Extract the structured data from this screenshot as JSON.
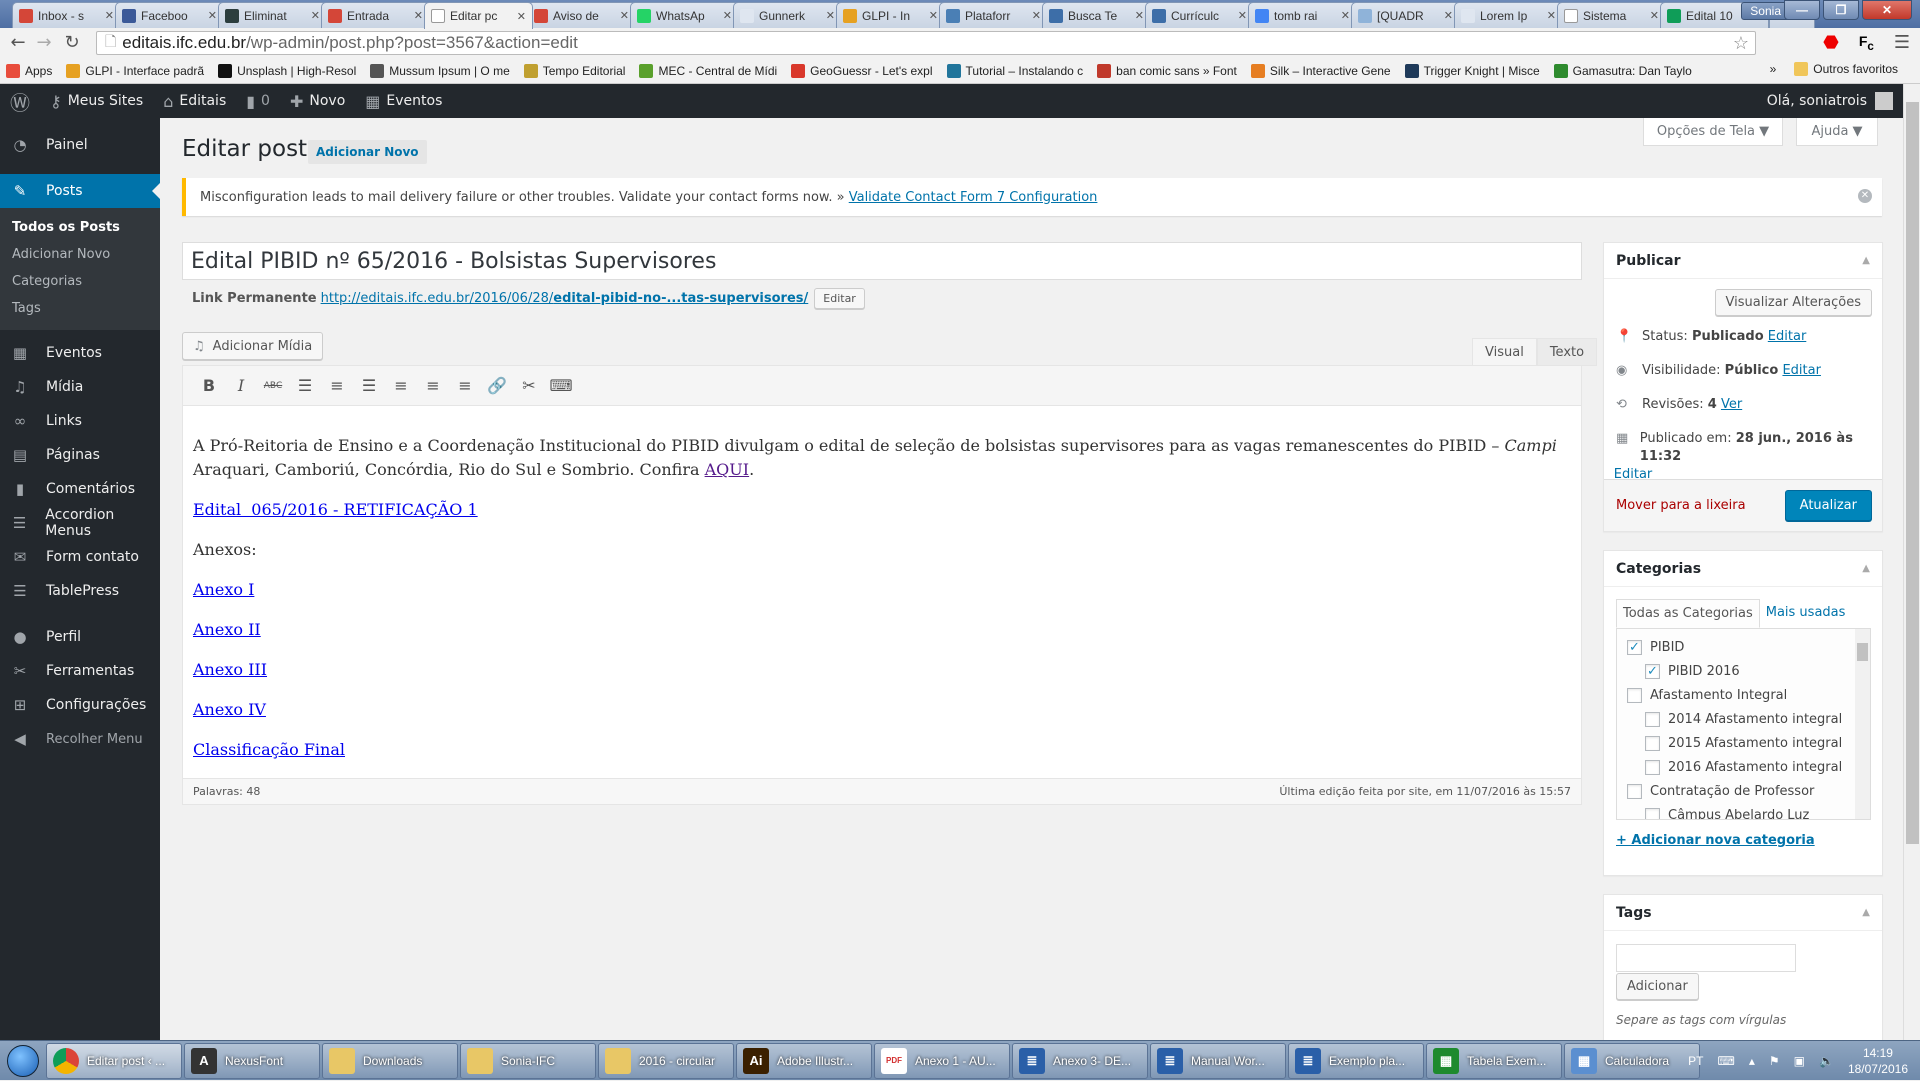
{
  "browser": {
    "tabs": [
      {
        "label": "Inbox - s",
        "icon": "gmail-icon",
        "color": "#d44638"
      },
      {
        "label": "Faceboo",
        "icon": "facebook-icon",
        "color": "#3b5998"
      },
      {
        "label": "Eliminat",
        "icon": "site-icon",
        "color": "#2c3e3e"
      },
      {
        "label": "Entrada",
        "icon": "gmail-icon",
        "color": "#d44638"
      },
      {
        "label": "Editar pc",
        "icon": "page-icon",
        "color": "#ffffff",
        "active": true
      },
      {
        "label": "Aviso de",
        "icon": "gmail-icon",
        "color": "#d44638"
      },
      {
        "label": "WhatsAp",
        "icon": "whatsapp-icon",
        "color": "#25d366"
      },
      {
        "label": "Gunnerk",
        "icon": "site-icon",
        "color": "#dfe6f0"
      },
      {
        "label": "GLPI - In",
        "icon": "glpi-icon",
        "color": "#e6a122"
      },
      {
        "label": "Plataforr",
        "icon": "site-icon",
        "color": "#4a7fb5"
      },
      {
        "label": "Busca Te",
        "icon": "lattes-icon",
        "color": "#3d6ea8"
      },
      {
        "label": "Currículc",
        "icon": "lattes-icon",
        "color": "#3d6ea8"
      },
      {
        "label": "tomb rai",
        "icon": "google-icon",
        "color": "#4285f4"
      },
      {
        "label": "[QUADR",
        "icon": "site-icon",
        "color": "#8fb3d9"
      },
      {
        "label": "Lorem Ip",
        "icon": "lorem-icon",
        "color": "#dfe6f0"
      },
      {
        "label": "Sistema",
        "icon": "page-icon",
        "color": "#ffffff"
      },
      {
        "label": "Edital 10",
        "icon": "sheets-icon",
        "color": "#0f9d58"
      }
    ],
    "profile": "Sonia",
    "url_host": "editais.ifc.edu.br",
    "url_path": "/wp-admin/post.php?post=3567&action=edit",
    "bookmarks": [
      {
        "label": "Apps",
        "color": "#e84d3c"
      },
      {
        "label": "GLPI - Interface padrã",
        "color": "#e6a122"
      },
      {
        "label": "Unsplash | High-Resol",
        "color": "#111111"
      },
      {
        "label": "Mussum Ipsum | O me",
        "color": "#555555"
      },
      {
        "label": "Tempo Editorial",
        "color": "#c0a030"
      },
      {
        "label": "MEC - Central de Mídi",
        "color": "#5aa02c"
      },
      {
        "label": "GeoGuessr - Let's expl",
        "color": "#d9382b"
      },
      {
        "label": "Tutorial – Instalando c",
        "color": "#21759b"
      },
      {
        "label": "ban comic sans » Font",
        "color": "#c0392b"
      },
      {
        "label": "Silk – Interactive Gene",
        "color": "#e67e22"
      },
      {
        "label": "Trigger Knight | Misce",
        "color": "#1f3a5a"
      },
      {
        "label": "Gamasutra: Dan Taylo",
        "color": "#2e8b2e"
      }
    ],
    "bookmarks_overflow": "»",
    "other_bookmarks": "Outros favoritos"
  },
  "adminbar": {
    "my_sites": "Meus Sites",
    "site": "Editais",
    "comments_count": "0",
    "new": "Novo",
    "events": "Eventos",
    "greeting": "Olá, soniatrois"
  },
  "sidebar": {
    "items": [
      {
        "label": "Painel",
        "icon": "dashboard-icon",
        "glyph": "◔"
      },
      {
        "label": "Posts",
        "icon": "pin-icon",
        "glyph": "✎",
        "current": true
      },
      {
        "label": "Eventos",
        "icon": "calendar-icon",
        "glyph": "▦"
      },
      {
        "label": "Mídia",
        "icon": "media-icon",
        "glyph": "♫"
      },
      {
        "label": "Links",
        "icon": "link-icon",
        "glyph": "∞"
      },
      {
        "label": "Páginas",
        "icon": "pages-icon",
        "glyph": "▤"
      },
      {
        "label": "Comentários",
        "icon": "comment-icon",
        "glyph": "▮"
      },
      {
        "label": "Accordion Menus",
        "icon": "list-icon",
        "glyph": "☰"
      },
      {
        "label": "Form contato",
        "icon": "mail-icon",
        "glyph": "✉"
      },
      {
        "label": "TablePress",
        "icon": "table-icon",
        "glyph": "☰"
      },
      {
        "label": "Perfil",
        "icon": "user-icon",
        "glyph": "●"
      },
      {
        "label": "Ferramentas",
        "icon": "wrench-icon",
        "glyph": "✂"
      },
      {
        "label": "Configurações",
        "icon": "settings-icon",
        "glyph": "⊞"
      },
      {
        "label": "Recolher Menu",
        "icon": "collapse-icon",
        "glyph": "◀"
      }
    ],
    "submenu": [
      "Todos os Posts",
      "Adicionar Novo",
      "Categorias",
      "Tags"
    ]
  },
  "main": {
    "screen_options": "Opções de Tela ▼",
    "help": "Ajuda ▼",
    "page_title": "Editar post",
    "add_new": "Adicionar Novo",
    "notice_text": "Misconfiguration leads to mail delivery failure or other troubles. Validate your contact forms now. » ",
    "notice_link": "Validate Contact Form 7 Configuration",
    "post_title": "Edital PIBID nº 65/2016 - Bolsistas Supervisores",
    "permalink_label": "Link Permanente",
    "permalink_base": "http://editais.ifc.edu.br/2016/06/28/",
    "permalink_slug": "edital-pibid-no-...tas-supervisores/",
    "permalink_edit": "Editar",
    "add_media": "Adicionar Mídia",
    "tab_visual": "Visual",
    "tab_text": "Texto",
    "toolbar": [
      {
        "name": "bold-icon",
        "glyph": "B"
      },
      {
        "name": "italic-icon",
        "glyph": "I"
      },
      {
        "name": "strikethrough-icon",
        "glyph": "ABC"
      },
      {
        "name": "bullet-list-icon",
        "glyph": "☰"
      },
      {
        "name": "numbered-list-icon",
        "glyph": "≡"
      },
      {
        "name": "blockquote-icon",
        "glyph": "☰"
      },
      {
        "name": "align-left-icon",
        "glyph": "≡"
      },
      {
        "name": "align-center-icon",
        "glyph": "≡"
      },
      {
        "name": "align-right-icon",
        "glyph": "≡"
      },
      {
        "name": "insert-link-icon",
        "glyph": "🔗"
      },
      {
        "name": "unlink-icon",
        "glyph": "✂"
      },
      {
        "name": "toolbar-toggle-icon",
        "glyph": "⌨"
      }
    ],
    "content": {
      "intro_before_italic": "A Pró-Reitoria de Ensino e a Coordenação Institucional do PIBID divulgam o edital de seleção de bolsistas supervisores para as vagas remanescentes do PIBID – ",
      "intro_italic": "Campi",
      "intro_after_italic": " Araquari, Camboriú, Concórdia, Rio do Sul e Sombrio. Confira ",
      "intro_link": "AQUI",
      "intro_end": ".",
      "edital_link": "Edital  065/2016 - RETIFICAÇÃO 1",
      "anexos_label": "Anexos:",
      "anexos": [
        "Anexo I",
        "Anexo II",
        "Anexo III",
        "Anexo IV"
      ],
      "final_link": "Classificação Final"
    },
    "word_count": "Palavras: 48",
    "last_edit": "Última edição feita por site, em 11/07/2016 às 15:57"
  },
  "publish": {
    "title": "Publicar",
    "preview": "Visualizar Alterações",
    "status_label": "Status: ",
    "status_value": "Publicado",
    "visibility_label": "Visibilidade: ",
    "visibility_value": "Público",
    "revisions_label": "Revisões: ",
    "revisions_value": "4",
    "revisions_link": "Ver",
    "published_label": "Publicado em: ",
    "published_value": "28 jun., 2016 às 11:32",
    "edit": "Editar",
    "trash": "Mover para a lixeira",
    "update": "Atualizar"
  },
  "categories": {
    "title": "Categorias",
    "tab_all": "Todas as Categorias",
    "tab_popular": "Mais usadas",
    "items": [
      {
        "label": "PIBID",
        "checked": true,
        "level": 0
      },
      {
        "label": "PIBID 2016",
        "checked": true,
        "level": 1
      },
      {
        "label": "Afastamento Integral",
        "checked": false,
        "level": 0
      },
      {
        "label": "2014 Afastamento integral",
        "checked": false,
        "level": 1
      },
      {
        "label": "2015 Afastamento integral",
        "checked": false,
        "level": 1
      },
      {
        "label": "2016 Afastamento integral",
        "checked": false,
        "level": 1
      },
      {
        "label": "Contratação de Professor",
        "checked": false,
        "level": 0
      },
      {
        "label": "Câmpus Abelardo Luz",
        "checked": false,
        "level": 1
      }
    ],
    "add_new": "+ Adicionar nova categoria"
  },
  "tags": {
    "title": "Tags",
    "input_value": "",
    "add": "Adicionar",
    "hint": "Separe as tags com vírgulas"
  },
  "taskbar": {
    "items": [
      {
        "label": "Editar post ‹ ...",
        "icon": "chrome-icon",
        "color": "#dd4b39",
        "active": true
      },
      {
        "label": "NexusFont",
        "icon": "nexusfont-icon",
        "color": "#333333",
        "glyph": "A"
      },
      {
        "label": "Downloads",
        "icon": "folder-icon",
        "color": "#e8c766"
      },
      {
        "label": "Sonia-IFC",
        "icon": "folder-icon",
        "color": "#e8c766"
      },
      {
        "label": "2016 - circular",
        "icon": "folder-icon",
        "color": "#e8c766"
      },
      {
        "label": "Adobe Illustr...",
        "icon": "illustrator-icon",
        "color": "#3b2000",
        "glyph": "Ai"
      },
      {
        "label": "Anexo 1 - AU...",
        "icon": "pdf-icon",
        "color": "#d32f2f",
        "glyph": "PDF"
      },
      {
        "label": "Anexo 3- DE...",
        "icon": "writer-icon",
        "color": "#2a5fa8",
        "glyph": "≣"
      },
      {
        "label": "Manual Wor...",
        "icon": "writer-icon",
        "color": "#2a5fa8",
        "glyph": "≣"
      },
      {
        "label": "Exemplo pla...",
        "icon": "writer-icon",
        "color": "#2a5fa8",
        "glyph": "≣"
      },
      {
        "label": "Tabela Exem...",
        "icon": "calc-sheet-icon",
        "color": "#1e8a2e",
        "glyph": "▦"
      },
      {
        "label": "Calculadora",
        "icon": "calculator-icon",
        "color": "#5b8fd0",
        "glyph": "▦"
      }
    ],
    "language": "PT",
    "time": "14:19",
    "date": "18/07/2016"
  }
}
